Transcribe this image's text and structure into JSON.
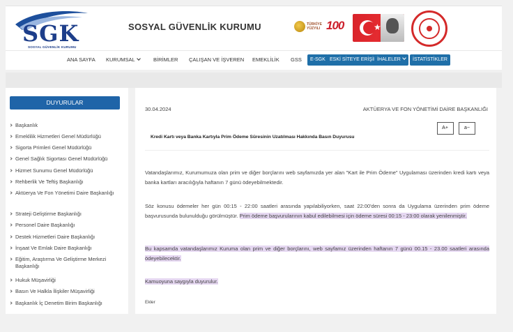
{
  "header": {
    "logo_text": "SGK",
    "logo_subtext": "SOSYAL GÜVENLİK KURUMU",
    "org_title": "SOSYAL GÜVENLİK KURUMU",
    "badge_tr_line1": "TÜRKİYE",
    "badge_tr_line2": "YÜZYILI",
    "badge_100": "100"
  },
  "nav": {
    "items": [
      "ANA SAYFA",
      "KURUMSAL",
      "BİRİMLER",
      "ÇALIŞAN VE İŞVEREN",
      "EMEKLİLİK",
      "GSS"
    ],
    "buttons": [
      "E-SGK",
      "ESKİ SİTEYE ERİŞİM",
      "İHALELER",
      "İSTATİSTİKLER"
    ]
  },
  "sidebar": {
    "title": "DUYURULAR",
    "items": [
      "Başkanlık",
      "Emeklilik Hizmetleri Genel Müdürlüğü",
      "Sigorta Primleri Genel Müdürlüğü",
      "Genel Sağlık Sigortası Genel Müdürlüğü",
      "Hizmet Sunumu Genel Müdürlüğü",
      "Rehberlik Ve Teftiş Başkanlığı",
      "Aktüerya Ve Fon Yönetimi Daire Başkanlığı",
      "Strateji Geliştirme Başkanlığı",
      "Personel Daire Başkanlığı",
      "Destek Hizmetleri Daire Başkanlığı",
      "İnşaat Ve Emlak Daire Başkanlığı",
      "Eğitim, Araştırma Ve Geliştirme Merkezi Başkanlığı",
      "Hukuk Müşavirliği",
      "Basın Ve Halkla İlişkiler Müşavirliği",
      "Başkanlık İç Denetim Birim Başkanlığı"
    ]
  },
  "article": {
    "date": "30.04.2024",
    "department": "AKTÜERYA VE FON YÖNETİMİ DAİRE BAŞKANLIĞI",
    "font_increase": "A+",
    "font_decrease": "a−",
    "headline": "Kredi Kartı veya Banka Kartıyla Prim Ödeme Süresinin Uzatılması Hakkında Basın Duyurusu",
    "p1": "Vatandaşlarımız, Kurumumuza olan prim ve diğer borçlarını web sayfamızda yer alan \"Kart ile Prim Ödeme\" Uygulaması üzerinden kredi kartı veya banka kartları aracılığıyla haftanın 7 günü ödeyebilmektedir.",
    "p2_plain": "Söz konusu ödemeler her gün 00:15 - 22:00 saatleri arasında yapılabiliyorken, saat 22:00'den sonra da Uygulama üzerinden prim ödeme başvurusunda bulunulduğu görülmüştür. ",
    "p2_highlight": "Prim ödeme başvurularının kabul edilebilmesi için ödeme süresi 00:15 - 23:00 olarak yenilenmiştir.",
    "p3": "Bu kapsamda vatandaşlarımız Kuruma olan prim ve diğer borçlarını, web sayfamız üzerinden haftanın 7 günü 00.15 - 23.00 saatleri arasında ödeyebilecektir.",
    "p4": "Kamuoyuna saygıyla duyurulur.",
    "attachments_label": "Ekler"
  }
}
